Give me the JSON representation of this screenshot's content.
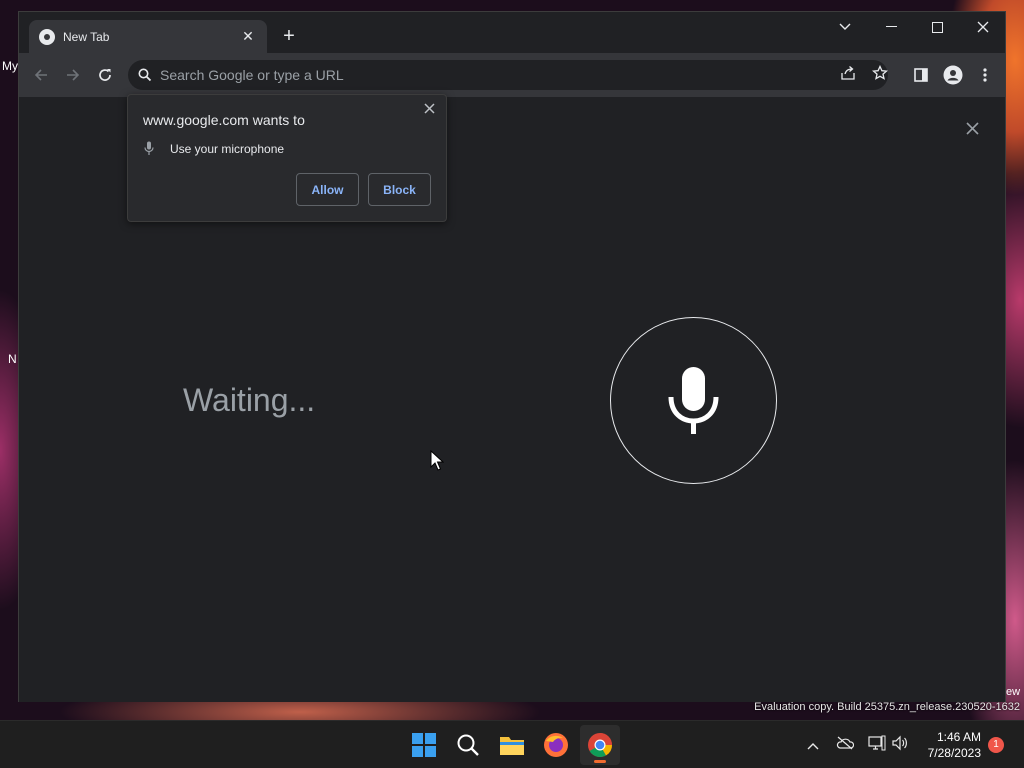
{
  "desktop": {
    "fragments": [
      "My",
      "N"
    ],
    "evaluation_text": "Evaluation copy. Build 25375.zn_release.230520-1632",
    "right_fragment": "ew"
  },
  "browser": {
    "tab": {
      "title": "New Tab",
      "favicon": "chrome-icon",
      "close_label": "✕"
    },
    "new_tab_label": "+",
    "window_controls": {
      "search_tabs": "⌄",
      "minimize": "—",
      "maximize": "☐",
      "close": "✕"
    },
    "omnibox": {
      "placeholder": "Search Google or type a URL"
    },
    "toolbar_icons": [
      "back-icon",
      "forward-icon",
      "reload-icon",
      "share-icon",
      "bookmark-star-icon",
      "side-panel-icon",
      "profile-icon",
      "menu-icon"
    ]
  },
  "voice_search": {
    "status": "Waiting...",
    "close_label": "✕"
  },
  "permission_prompt": {
    "title": "www.google.com wants to",
    "item": "Use your microphone",
    "allow_label": "Allow",
    "block_label": "Block",
    "close_label": "✕"
  },
  "taskbar": {
    "apps": [
      "start-icon",
      "search-icon",
      "file-explorer-icon",
      "firefox-icon",
      "chrome-icon"
    ],
    "active_app": "chrome-icon",
    "clock": {
      "time": "1:46 AM",
      "date": "7/28/2023"
    },
    "notification_count": "1",
    "colors": {
      "accent": "#f06b2f",
      "badge": "#f0564a"
    }
  }
}
